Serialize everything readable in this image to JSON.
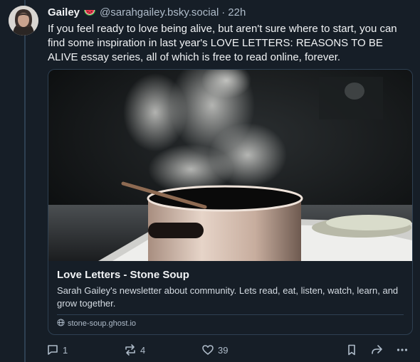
{
  "post": {
    "display_name": "Gailey",
    "emoji": "watermelon",
    "handle": "@sarahgailey.bsky.social",
    "separator": "·",
    "time": "22h",
    "text": "If you feel ready to love being alive, but aren't sure where to start, you can find some inspiration in last year's LOVE LETTERS: REASONS TO BE ALIVE essay series, all of which is free to read online, forever."
  },
  "card": {
    "title": "Love Letters - Stone Soup",
    "description": "Sarah Gailey's newsletter about community. Lets read, eat, listen, watch, learn, and grow together.",
    "domain": "stone-soup.ghost.io"
  },
  "actions": {
    "replies": "1",
    "reposts": "4",
    "likes": "39"
  },
  "colors": {
    "background": "#161e27",
    "border": "#2e4052",
    "muted": "#aebbc9"
  }
}
